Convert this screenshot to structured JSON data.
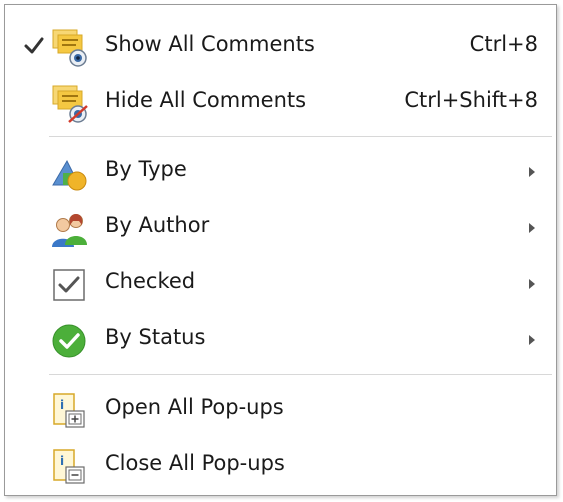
{
  "menu": {
    "items": [
      {
        "label": "Show All Comments",
        "shortcut": "Ctrl+8",
        "checked": true,
        "icon": "show-comments-icon"
      },
      {
        "label": "Hide All Comments",
        "shortcut": "Ctrl+Shift+8",
        "checked": false,
        "icon": "hide-comments-icon"
      },
      {
        "label": "By Type",
        "submenu": true,
        "icon": "shapes-icon"
      },
      {
        "label": "By Author",
        "submenu": true,
        "icon": "users-icon"
      },
      {
        "label": "Checked",
        "submenu": true,
        "icon": "checkbox-icon"
      },
      {
        "label": "By Status",
        "submenu": true,
        "icon": "green-check-icon"
      },
      {
        "label": "Open All Pop-ups",
        "icon": "open-popups-icon"
      },
      {
        "label": "Close All Pop-ups",
        "icon": "close-popups-icon"
      }
    ]
  },
  "colors": {
    "text": "#1a1a1a",
    "separator": "#d8d8d8",
    "border": "#9a9a9a",
    "note_yellow": "#f5c842",
    "status_green": "#4caf3a",
    "popup_blue": "#2f6fb3"
  }
}
